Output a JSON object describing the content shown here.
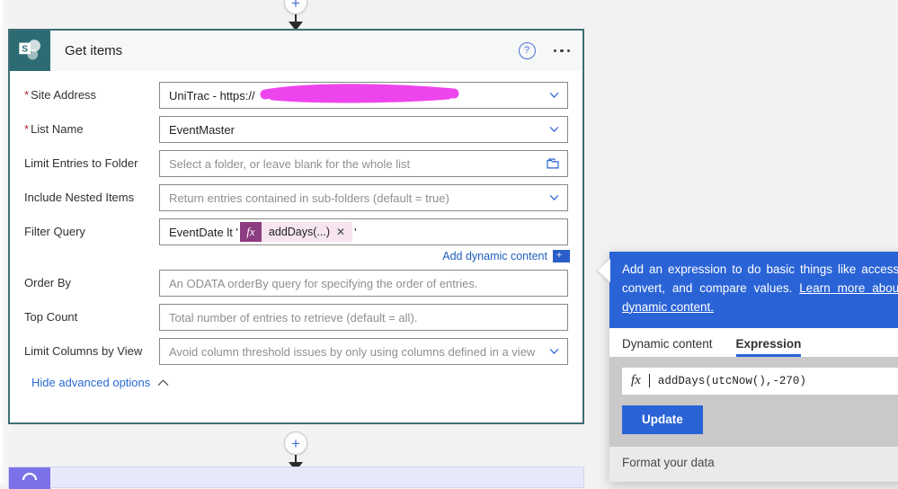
{
  "flow": {
    "add_step_label": "+",
    "top_connector_icon": "plus-circle-icon",
    "bottom_connector_icon": "plus-circle-icon"
  },
  "card": {
    "icon": "sharepoint-icon",
    "title": "Get items",
    "help_icon": "help-circle-icon",
    "more_icon": "ellipsis-icon",
    "fields": [
      {
        "label": "Site Address",
        "required": true,
        "value": "UniTrac - https://",
        "placeholder": "",
        "control": "dropdown",
        "redacted": true
      },
      {
        "label": "List Name",
        "required": true,
        "value": "EventMaster",
        "placeholder": "",
        "control": "dropdown",
        "redacted": false
      },
      {
        "label": "Limit Entries to Folder",
        "required": false,
        "value": "",
        "placeholder": "Select a folder, or leave blank for the whole list",
        "control": "folder-picker",
        "redacted": false
      },
      {
        "label": "Include Nested Items",
        "required": false,
        "value": "",
        "placeholder": "Return entries contained in sub-folders (default = true)",
        "control": "dropdown",
        "redacted": false
      }
    ],
    "filter_query": {
      "label": "Filter Query",
      "text_before": "EventDate lt '",
      "token": {
        "fx_label": "fx",
        "text": "addDays(...)",
        "remove_icon": "close-icon"
      },
      "text_after": "'"
    },
    "add_dynamic_content": {
      "label": "Add dynamic content",
      "badge": "+"
    },
    "fields_lower": [
      {
        "label": "Order By",
        "required": false,
        "value": "",
        "placeholder": "An ODATA orderBy query for specifying the order of entries.",
        "control": "text"
      },
      {
        "label": "Top Count",
        "required": false,
        "value": "",
        "placeholder": "Total number of entries to retrieve (default = all).",
        "control": "text"
      },
      {
        "label": "Limit Columns by View",
        "required": false,
        "value": "",
        "placeholder": "Avoid column threshold issues by only using columns defined in a view",
        "control": "dropdown"
      }
    ],
    "advanced_toggle": {
      "label": "Hide advanced options",
      "icon": "chevron-up-icon"
    }
  },
  "flyout": {
    "banner": {
      "text": "Add an expression to do basic things like access, convert, and compare values. ",
      "link_text": "Learn more about dynamic content."
    },
    "tabs": [
      {
        "label": "Dynamic content",
        "active": false
      },
      {
        "label": "Expression",
        "active": true
      }
    ],
    "expression_input": {
      "fx_label": "fx",
      "value": "addDays(utcNow(),-270)"
    },
    "update_button": "Update",
    "footer_text": "Format your data"
  },
  "next_node": {
    "icon": "loop-icon"
  },
  "colors": {
    "accent_blue": "#2a63d6",
    "sharepoint_teal": "#2d6b73",
    "card_border": "#3d6f75",
    "token_fx": "#8c3c80",
    "token_body": "#f6e4f1",
    "redaction_magenta": "#ee44ee",
    "purple_node": "#7b72e9"
  }
}
